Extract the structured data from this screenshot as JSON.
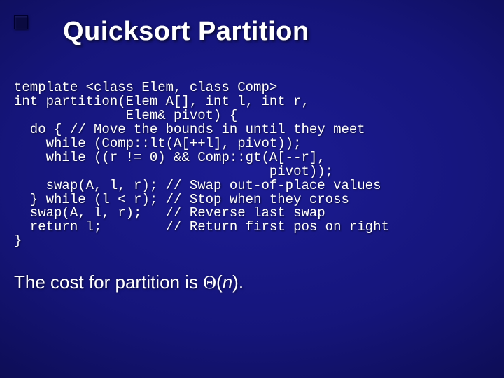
{
  "title": "Quicksort Partition",
  "code": "template <class Elem, class Comp>\nint partition(Elem A[], int l, int r,\n              Elem& pivot) {\n  do { // Move the bounds in until they meet\n    while (Comp::lt(A[++l], pivot));\n    while ((r != 0) && Comp::gt(A[--r],\n                                pivot));\n    swap(A, l, r); // Swap out-of-place values\n  } while (l < r); // Stop when they cross\n  swap(A, l, r);   // Reverse last swap\n  return l;        // Return first pos on right\n}",
  "cost": {
    "prefix": "The cost for partition is ",
    "theta": "Θ",
    "open": "(",
    "var": "n",
    "close": ")."
  }
}
